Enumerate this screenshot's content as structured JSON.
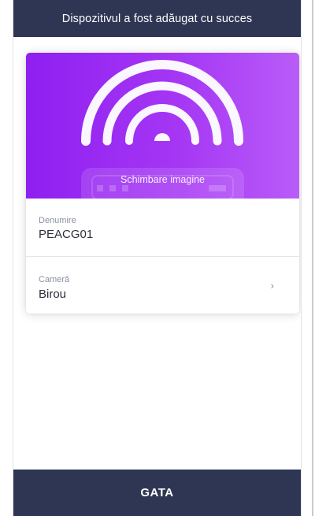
{
  "header": {
    "title": "Dispozitivul a fost adăugat cu succes"
  },
  "hero": {
    "change_image_label": "Schimbare imagine",
    "icon": "wifi-arcs-icon",
    "gradient_start": "#8f1ff0",
    "gradient_end": "#b95cf8"
  },
  "fields": {
    "name": {
      "label": "Denumire",
      "value": "PEACG01"
    },
    "room": {
      "label": "Cameră",
      "value": "Birou",
      "chevron": "›"
    }
  },
  "footer": {
    "done_label": "GATA"
  },
  "colors": {
    "bar": "#2f3654",
    "accent": "#a536f4"
  }
}
